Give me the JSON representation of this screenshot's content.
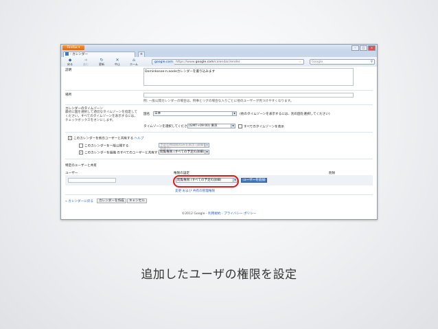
{
  "browser": {
    "app_button": "Firefox",
    "tab_title": "- カレンダー",
    "nav": {
      "back": "戻る",
      "forward": "進む",
      "reload": "更新",
      "stop": "中止",
      "home": "ホーム"
    },
    "site_label": "google.com",
    "url_prefix": "https://www.",
    "url_domain": "google.com",
    "url_suffix": "/calendar/render",
    "search_engine": "Google"
  },
  "form": {
    "description_label": "説明",
    "description_value": "Dominkosoe-n.aooleカレンダーを書り込みます",
    "location_label": "場所",
    "location_hint": "例: 一般公開カレンダーの場合は、例事とリグの場合な入りごとに他のユーザーが見つけやすくなります。",
    "timezone_label": "カレンダーのタイムゾーン",
    "timezone_help": "最初に国を選択して適切なタイムゾーンを指定してください。すべてのタイムゾーンを表示するには、チェックボックスをオンにします。",
    "country_label": "国名",
    "country_value": "日本",
    "country_hint": "(他のタイムゾーンを表示するには、別の国を選択してください)",
    "tz_select_label": "タイムゾーンを選択してください:",
    "tz_value": "(GMT+09:00) 東京",
    "tz_all_label": "すべてのタイムゾーンを表示",
    "share_label": "このカレンダーを他のユーザーと共有する",
    "share_help": "ヘルプ",
    "public_label": "このカレンダーを一般公開する",
    "public_select": "予定の時間枠のみを表示 (詳細を非表示)",
    "domain_label": "このカレンダーを組織 のすべてのユーザーと共有する",
    "domain_select": "閲覧権限 (すべての予定の詳細)",
    "specific_title": "特定のユーザーと共有",
    "col_user": "ユーザー",
    "col_permission": "権限の設定",
    "col_delete": "削除",
    "permission_select": "閲覧権限 (すべての予定の詳細)",
    "add_user_button": "ユーザーを追加",
    "perm_link": "変更 および 共有の管理権限",
    "back_link": "« カレンダーに戻る",
    "create_button": "カレンダーを作成",
    "cancel_button": "キャンセル",
    "footer_copy": "©2012 Google",
    "footer_terms": "利用規約",
    "footer_privacy": "プライバシー ポリシー"
  },
  "caption": "追加したユーザの権限を設定",
  "colors": {
    "highlight_ring": "#d81c1c",
    "link": "#2b5ec7",
    "firefox_button": "#e67e22"
  }
}
